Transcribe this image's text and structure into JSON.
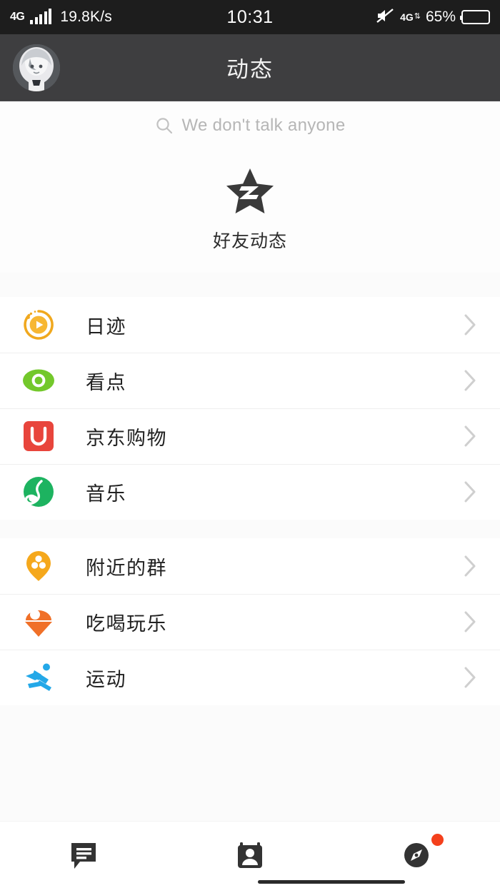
{
  "status_bar": {
    "network_type": "4G",
    "speed": "19.8K/s",
    "time": "10:31",
    "data_label": "4G",
    "battery_percent": "65%",
    "mute_icon": "muted-speaker-icon",
    "signal_icon": "signal-bars-icon",
    "battery_icon": "battery-icon",
    "battery_fill_percent": 65
  },
  "header": {
    "title": "动态",
    "avatar_name": "user-avatar"
  },
  "search": {
    "placeholder": "We don't talk anyone",
    "icon": "search-icon"
  },
  "zone": {
    "label": "好友动态",
    "icon": "qzone-star-icon",
    "icon_color": "#3a3a3a"
  },
  "list_groups": [
    {
      "items": [
        {
          "label": "日迹",
          "icon": "daily-trace-icon",
          "color": "#f5a623",
          "chevron": "chevron-right-icon"
        },
        {
          "label": "看点",
          "icon": "kandian-eye-icon",
          "color": "#73c82b",
          "chevron": "chevron-right-icon"
        },
        {
          "label": "京东购物",
          "icon": "jd-shopping-icon",
          "color": "#e8453c",
          "chevron": "chevron-right-icon"
        },
        {
          "label": "音乐",
          "icon": "music-note-icon",
          "color": "#1db360",
          "chevron": "chevron-right-icon"
        }
      ]
    },
    {
      "items": [
        {
          "label": "附近的群",
          "icon": "nearby-group-pin-icon",
          "color": "#f5a81c",
          "chevron": "chevron-right-icon"
        },
        {
          "label": "吃喝玩乐",
          "icon": "food-fun-cone-icon",
          "color": "#f07028",
          "chevron": "chevron-right-icon"
        },
        {
          "label": "运动",
          "icon": "sports-runner-icon",
          "color": "#23a8e8",
          "chevron": "chevron-right-icon"
        }
      ]
    }
  ],
  "bottom_nav": {
    "items": [
      {
        "name": "messages",
        "icon": "chat-bubble-icon",
        "active": false,
        "badge": false
      },
      {
        "name": "contacts",
        "icon": "contacts-card-icon",
        "active": false,
        "badge": false
      },
      {
        "name": "discover",
        "icon": "compass-icon",
        "active": true,
        "badge": true
      }
    ],
    "badge_color": "#f4401c",
    "icon_color": "#333333"
  }
}
